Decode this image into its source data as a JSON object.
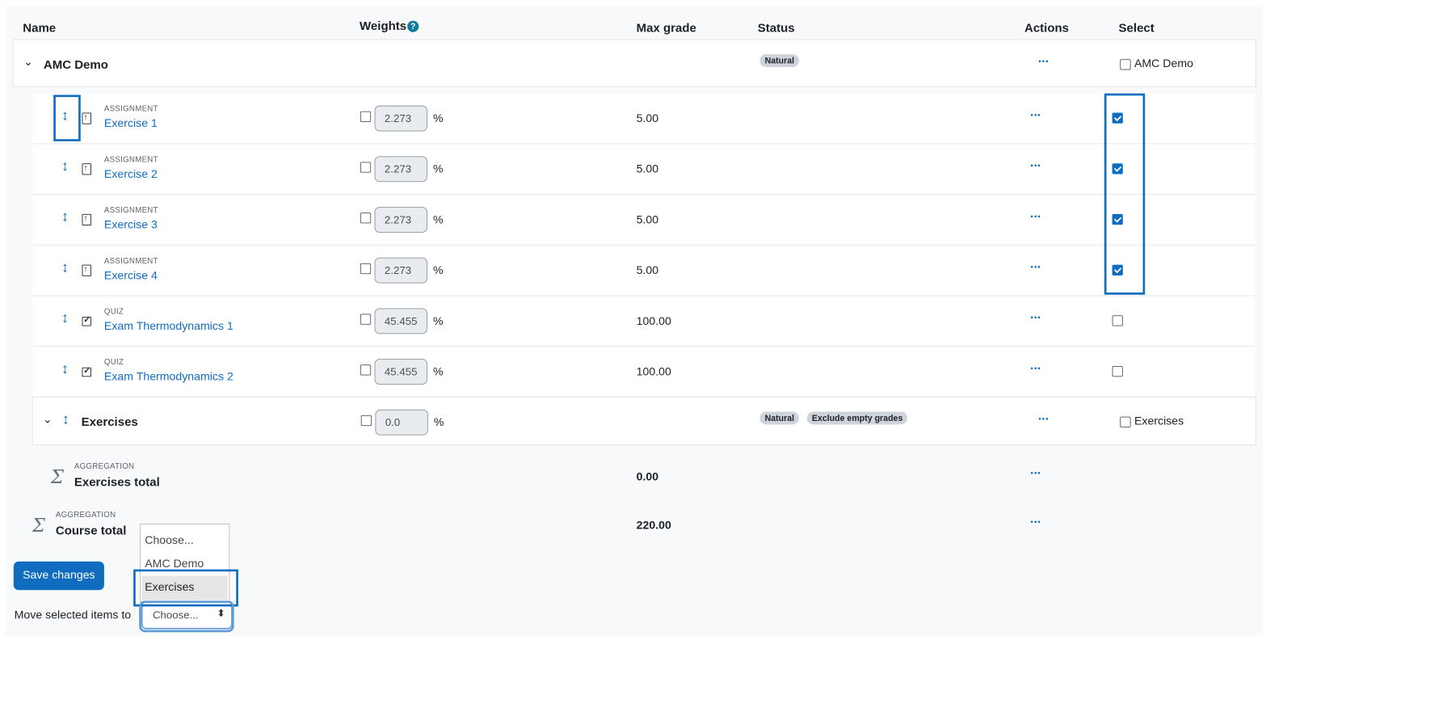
{
  "headers": {
    "name": "Name",
    "weights": "Weights",
    "max_grade": "Max grade",
    "status": "Status",
    "actions": "Actions",
    "select": "Select"
  },
  "help_icon": "?",
  "actions_glyph": "···",
  "category_amc": {
    "name": "AMC Demo",
    "badge": "Natural",
    "select_label": "AMC Demo"
  },
  "items": [
    {
      "type": "ASSIGNMENT",
      "name": "Exercise 1",
      "weight": "2.273",
      "max": "5.00",
      "selected": true
    },
    {
      "type": "ASSIGNMENT",
      "name": "Exercise 2",
      "weight": "2.273",
      "max": "5.00",
      "selected": true
    },
    {
      "type": "ASSIGNMENT",
      "name": "Exercise 3",
      "weight": "2.273",
      "max": "5.00",
      "selected": true
    },
    {
      "type": "ASSIGNMENT",
      "name": "Exercise 4",
      "weight": "2.273",
      "max": "5.00",
      "selected": true
    },
    {
      "type": "QUIZ",
      "name": "Exam Thermodynamics 1",
      "weight": "45.455",
      "max": "100.00",
      "selected": false
    },
    {
      "type": "QUIZ",
      "name": "Exam Thermodynamics 2",
      "weight": "45.455",
      "max": "100.00",
      "selected": false
    }
  ],
  "percent": "%",
  "category_ex": {
    "name": "Exercises",
    "weight": "0.0",
    "badges": [
      "Natural",
      "Exclude empty grades"
    ],
    "select_label": "Exercises"
  },
  "exercises_total": {
    "type": "AGGREGATION",
    "name": "Exercises total",
    "max": "0.00"
  },
  "course_total": {
    "type": "AGGREGATION",
    "name": "Course total",
    "max": "220.00"
  },
  "save_button": "Save changes",
  "move_label": "Move selected items to",
  "dropdown": {
    "selected": "Choose...",
    "options": [
      "Choose...",
      "AMC Demo",
      "Exercises"
    ]
  }
}
